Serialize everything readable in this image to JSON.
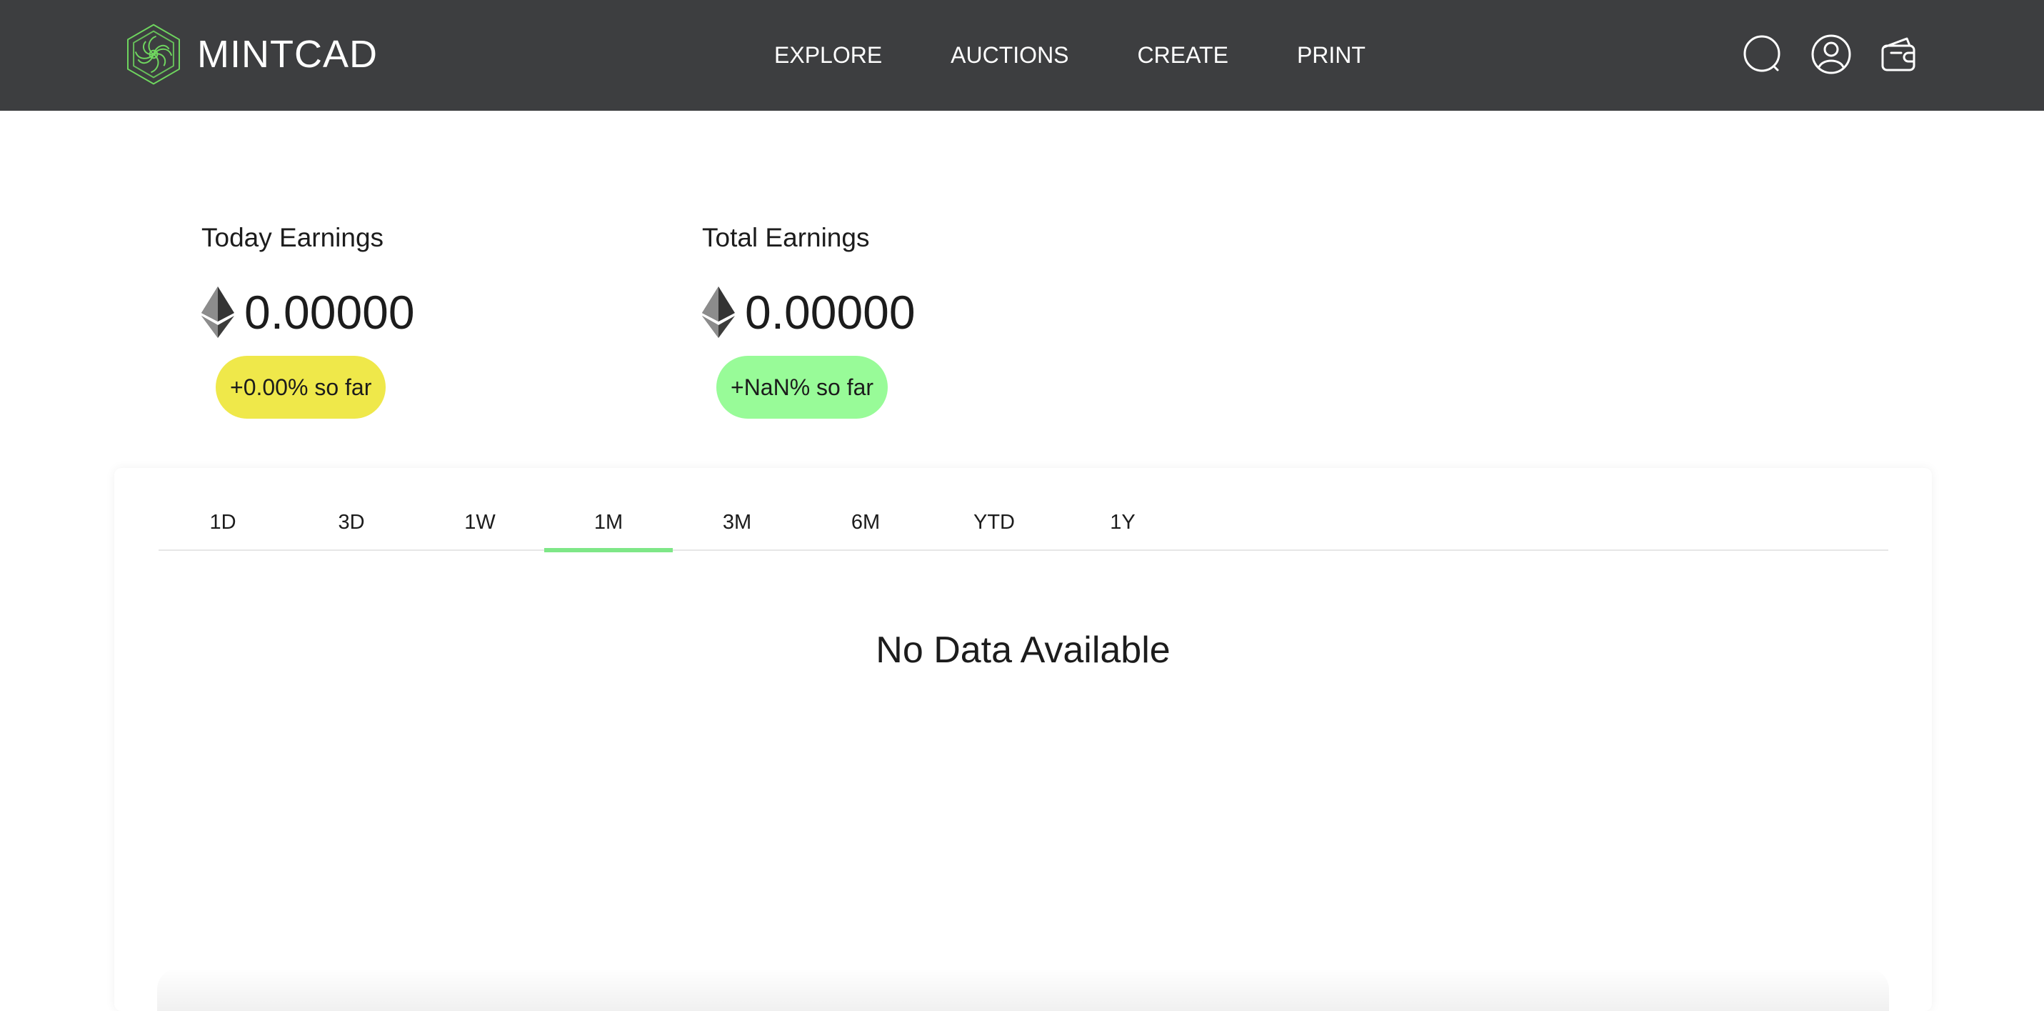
{
  "brand": {
    "name": "MINTCAD",
    "accent_color": "#7ee787"
  },
  "nav": {
    "items": [
      {
        "label": "EXPLORE"
      },
      {
        "label": "AUCTIONS"
      },
      {
        "label": "CREATE"
      },
      {
        "label": "PRINT"
      }
    ]
  },
  "header_icons": [
    "search-icon",
    "user-profile-icon",
    "wallet-icon"
  ],
  "earnings": {
    "today": {
      "label": "Today Earnings",
      "value": "0.00000",
      "change": "+0.00% so far",
      "change_color": "#efe84a",
      "currency_icon": "ethereum-icon"
    },
    "total": {
      "label": "Total Earnings",
      "value": "0.00000",
      "change": "+NaN% so far",
      "change_color": "#98fb98",
      "currency_icon": "ethereum-icon"
    }
  },
  "chart": {
    "tabs": [
      {
        "label": "1D",
        "active": false
      },
      {
        "label": "3D",
        "active": false
      },
      {
        "label": "1W",
        "active": false
      },
      {
        "label": "1M",
        "active": true
      },
      {
        "label": "3M",
        "active": false
      },
      {
        "label": "6M",
        "active": false
      },
      {
        "label": "YTD",
        "active": false
      },
      {
        "label": "1Y",
        "active": false
      }
    ],
    "empty_message": "No Data Available"
  }
}
